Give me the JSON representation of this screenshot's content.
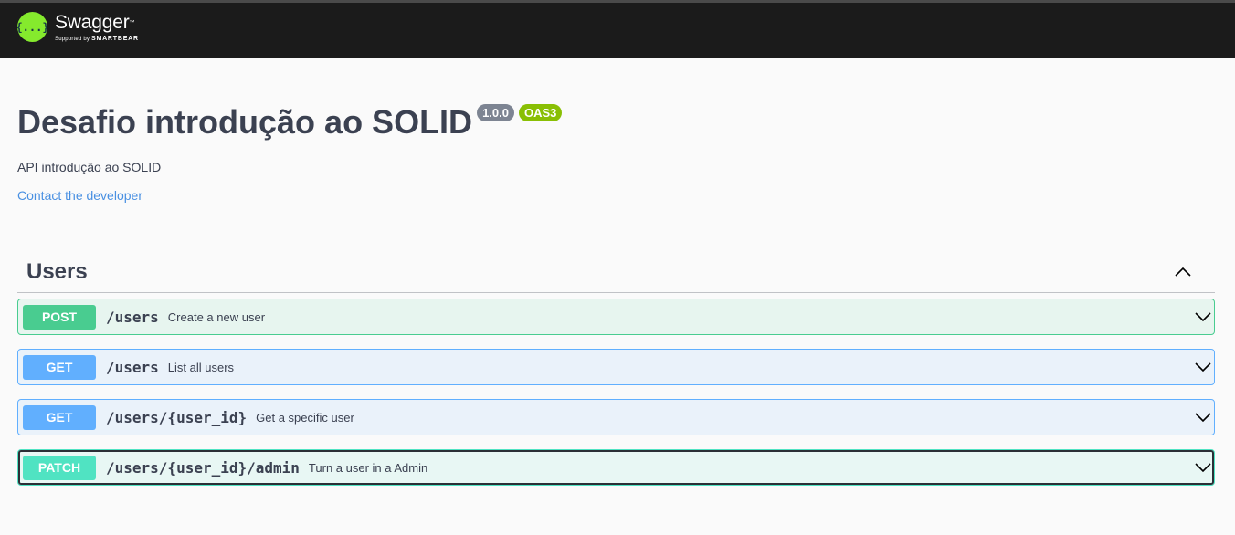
{
  "topbar": {
    "logo_name": "Swagger",
    "logo_tm": "™",
    "logo_sub_prefix": "Supported by",
    "logo_sub_brand": "SMARTBEAR",
    "logo_icon_text": "{...}",
    "logo_icon": "swagger-logo-icon"
  },
  "info": {
    "title": "Desafio introdução ao SOLID",
    "version": "1.0.0",
    "oas": "OAS3",
    "description": "API introdução ao SOLID",
    "contact": "Contact the developer"
  },
  "tag": {
    "name": "Users",
    "toggle_icon": "chevron-up-icon"
  },
  "operations": [
    {
      "method": "POST",
      "path": "/users",
      "summary": "Create a new user"
    },
    {
      "method": "GET",
      "path": "/users",
      "summary": "List all users"
    },
    {
      "method": "GET",
      "path": "/users/{user_id}",
      "summary": "Get a specific user"
    },
    {
      "method": "PATCH",
      "path": "/users/{user_id}/admin",
      "summary": "Turn a user in a Admin"
    }
  ],
  "colors": {
    "topbar_bg": "#1b1b1b",
    "logo_green": "#85ea2d",
    "post": "#49cc90",
    "get": "#61affe",
    "patch": "#50e3c2",
    "badge_version": "#7d8492",
    "badge_oas": "#89bf04",
    "link": "#4990e2"
  }
}
